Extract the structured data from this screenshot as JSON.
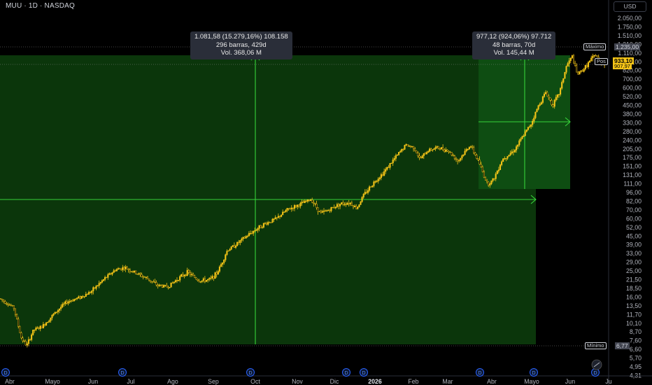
{
  "header": {
    "symbol": "MUU",
    "interval": "1D",
    "exchange": "NASDAQ",
    "title": "MUU · 1D · NASDAQ"
  },
  "currency_button": "USD",
  "price_axis": {
    "ticks": [
      "2.050,00",
      "1.750,00",
      "1.510,00",
      "1.310,00",
      "1.110,00",
      "960,00",
      "820,00",
      "700,00",
      "600,00",
      "520,00",
      "450,00",
      "380,00",
      "330,00",
      "280,00",
      "240,00",
      "205,00",
      "175,00",
      "151,00",
      "131,00",
      "111,00",
      "96,00",
      "82,00",
      "70,00",
      "60,00",
      "52,00",
      "45,00",
      "39,00",
      "33,00",
      "29,00",
      "25,00",
      "21,50",
      "18,50",
      "16,00",
      "13,50",
      "11,70",
      "10,10",
      "8,70",
      "7,60",
      "6,60",
      "5,70",
      "4,95",
      "4,31"
    ],
    "labels": {
      "maximo": "Máximo",
      "maximo_value": "1.235,00",
      "pos": "Pos",
      "last_price": "933,10",
      "last_price_sub": "907,97",
      "minimo": "Mínimo",
      "minimo_value": "6,77"
    }
  },
  "time_axis": {
    "labels": [
      "Abr",
      "Mayo",
      "Jun",
      "Jul",
      "Ago",
      "Sep",
      "Oct",
      "Nov",
      "Dic",
      "2026",
      "Feb",
      "Mar",
      "Abr",
      "Mayo",
      "Jun",
      "Ju"
    ]
  },
  "measurements": [
    {
      "line1": "1.081,58 (15.279,16%) 108.158",
      "line2": "296 barras, 429d",
      "line3": "Vol. 368,06 M"
    },
    {
      "line1": "977,12 (924,06%) 97.712",
      "line2": "48 barras, 70d",
      "line3": "Vol. 145,44 M"
    }
  ],
  "colors": {
    "background": "#000000",
    "candle": "#f5c518",
    "measure_fill": "#0c3a0c",
    "measure_line": "#2ecc40",
    "marker": "#2962ff"
  },
  "chart_data": {
    "type": "candlestick",
    "symbol": "MUU",
    "interval": "1D",
    "scale": "log",
    "ylim": [
      4.31,
      2050
    ],
    "x_range": [
      "Abr",
      "Jul (next year)"
    ],
    "series": [
      {
        "points": [
          [
            "Abr",
            15.5
          ],
          [
            "Abr",
            8.5
          ],
          [
            "Abr",
            7.2
          ],
          [
            "Mayo",
            10.0
          ],
          [
            "Mayo",
            13.5
          ],
          [
            "Jun",
            15.0
          ],
          [
            "Jun",
            18.0
          ],
          [
            "Jul",
            24.0
          ],
          [
            "Jul",
            25.5
          ],
          [
            "Ago",
            21.0
          ],
          [
            "Ago",
            19.0
          ],
          [
            "Ago",
            23.0
          ],
          [
            "Sep",
            21.0
          ],
          [
            "Sep",
            22.0
          ],
          [
            "Sep",
            35.0
          ],
          [
            "Oct",
            49.0
          ],
          [
            "Oct",
            54.0
          ],
          [
            "Nov",
            70.0
          ],
          [
            "Nov",
            85.0
          ],
          [
            "Nov",
            60.0
          ],
          [
            "Dic",
            72.0
          ],
          [
            "Dic",
            85.0
          ],
          [
            "2026",
            95.0
          ],
          [
            "2026",
            150.0
          ],
          [
            "Feb",
            225.0
          ],
          [
            "Feb",
            165.0
          ],
          [
            "Mar",
            210.0
          ],
          [
            "Mar",
            175.0
          ],
          [
            "Mar",
            230.0
          ],
          [
            "Abr",
            105.0
          ],
          [
            "Abr",
            140.0
          ],
          [
            "Abr",
            200.0
          ],
          [
            "Mayo",
            300.0
          ],
          [
            "Mayo",
            520.0
          ],
          [
            "Mayo",
            450.0
          ],
          [
            "Jun",
            700.0
          ],
          [
            "Jun",
            1110.0
          ],
          [
            "Jun",
            750.0
          ],
          [
            "Jun",
            1000.0
          ],
          [
            "Jun",
            933.1
          ]
        ]
      }
    ],
    "annotations": {
      "max": 1235.0,
      "min": 6.77,
      "last": 933.1
    }
  }
}
